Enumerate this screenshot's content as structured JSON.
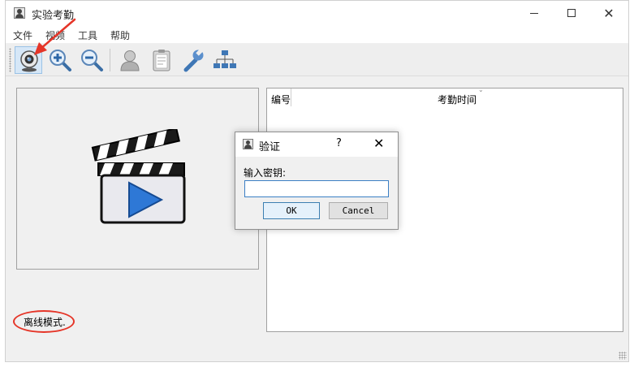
{
  "window": {
    "title": "实验考勤",
    "controls": {
      "minimize": "",
      "maximize": "",
      "close": "✕"
    }
  },
  "menu": [
    {
      "label": "文件"
    },
    {
      "label": "视频"
    },
    {
      "label": "工具"
    },
    {
      "label": "帮助"
    }
  ],
  "toolbar": {
    "items": [
      {
        "icon": "webcam-icon",
        "active": true
      },
      {
        "icon": "zoom-in-icon",
        "active": false
      },
      {
        "icon": "zoom-out-icon",
        "active": false
      },
      {
        "icon": "user-icon",
        "active": false
      },
      {
        "icon": "clipboard-icon",
        "active": false
      },
      {
        "icon": "wrench-icon",
        "active": false
      },
      {
        "icon": "network-icon",
        "active": false
      }
    ]
  },
  "video": {
    "icon": "video-clapperboard-icon"
  },
  "status": {
    "text": "离线模式."
  },
  "table": {
    "columns": [
      "编号",
      "考勤时间"
    ],
    "rows": []
  },
  "dialog": {
    "title": "验证",
    "help": "?",
    "close": "✕",
    "prompt": "输入密钥:",
    "input_value": "",
    "ok_label": "OK",
    "cancel_label": "Cancel"
  },
  "annotations": {
    "color": "#e53528"
  }
}
